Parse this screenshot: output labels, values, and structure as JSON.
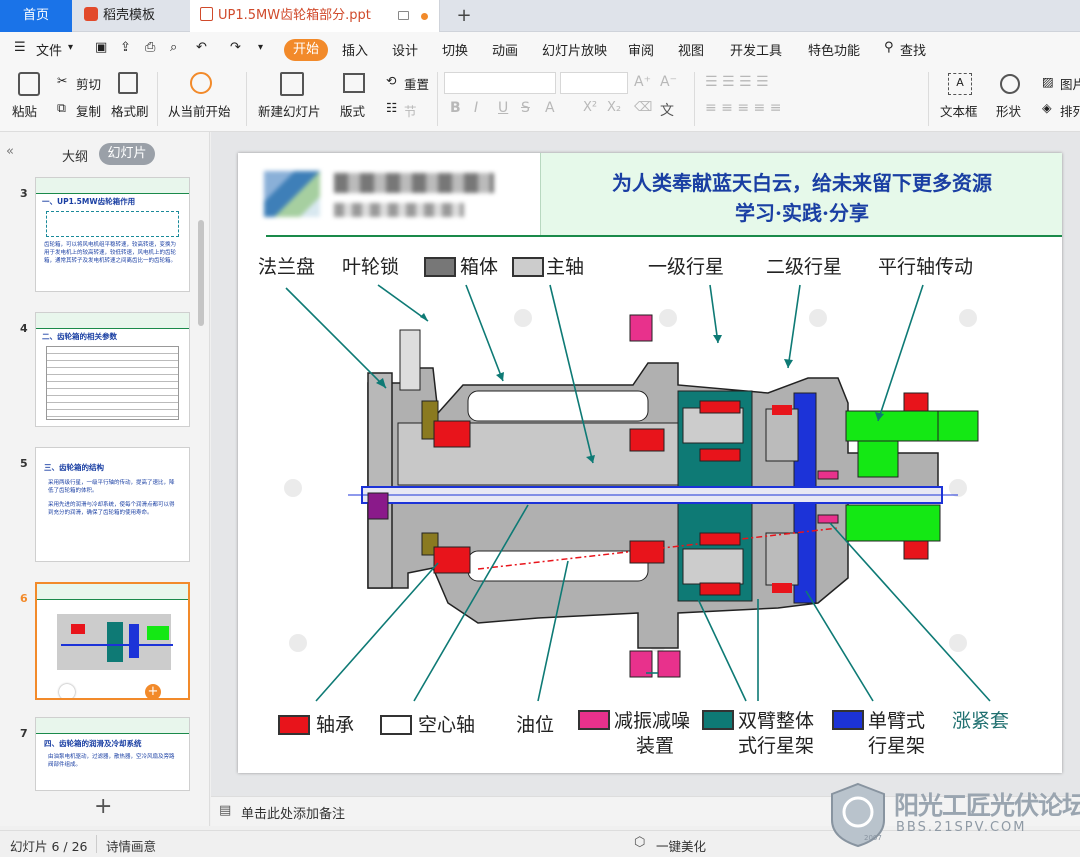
{
  "tabs": {
    "home": "首页",
    "template": "稻壳模板",
    "file": "UP1.5MW齿轮箱部分.ppt"
  },
  "menu": {
    "file": "文件",
    "items": [
      "开始",
      "插入",
      "设计",
      "切换",
      "动画",
      "幻灯片放映",
      "审阅",
      "视图",
      "开发工具",
      "特色功能"
    ],
    "search": "查找"
  },
  "ribbon": {
    "paste": "粘贴",
    "cut": "剪切",
    "copy": "复制",
    "format_painter": "格式刷",
    "from_current": "从当前开始",
    "new_slide": "新建幻灯片",
    "layout": "版式",
    "reset": "重置",
    "section": "节",
    "textbox": "文本框",
    "shape": "形状",
    "picture": "图片",
    "arrange": "排列"
  },
  "panel": {
    "outline": "大纲",
    "slides": "幻灯片",
    "thumbs": [
      {
        "num": "3",
        "title": "一、UP1.5MW齿轮箱作用",
        "body": "齿轮箱，可以将风电机组平稳转速，较高转速，变换为用于发电机上的较高转速，较低转速，风电机上的齿轮箱，通常其转子及发电机转速之间离齿比一的齿轮箱。"
      },
      {
        "num": "4",
        "title": "二、齿轮箱的相关参数"
      },
      {
        "num": "5",
        "title": "三、齿轮箱的结构",
        "body": "采用两级行星，一级平行轴的传动，提高了速比，降低了齿轮箱的体积。",
        "body2": "采用先进的润滑与冷却系统，使每个润滑点都可以得到充分的润滑，确保了齿轮箱的使用寿命。"
      },
      {
        "num": "6"
      },
      {
        "num": "7",
        "title": "四、齿轮箱的润滑及冷却系统",
        "body": "由油泵电机驱动，过滤器，散热器，空冷风扇及旁路阀部件组成。"
      }
    ]
  },
  "slide": {
    "header_line1": "为人类奉献蓝天白云，给未来留下更多资源",
    "header_line2": "学习·实践·分享",
    "top_labels": {
      "flange": "法兰盘",
      "rotor_lock": "叶轮锁",
      "housing": "箱体",
      "main_shaft": "主轴",
      "stage1": "一级行星",
      "stage2": "二级行星",
      "parallel": "平行轴传动"
    },
    "bottom_labels": {
      "bearing": "轴承",
      "hollow": "空心轴",
      "oil": "油位",
      "damper1": "减振减噪",
      "damper2": "装置",
      "double1": "双臂整体",
      "double2": "式行星架",
      "single1": "单臂式",
      "single2": "行星架",
      "shrink": "涨紧套"
    },
    "watermark": "阳光工匠论坛"
  },
  "notes": "单击此处添加备注",
  "status": {
    "slide": "幻灯片 6 / 26",
    "theme": "诗情画意",
    "beautify": "一键美化"
  },
  "brand": {
    "name": "阳光工匠光伏论坛",
    "url": "BBS.21SPV.COM",
    "year": "2007"
  },
  "colors": {
    "accent": "#1a73e8",
    "orange": "#f28a2a",
    "teal": "#0e7a75",
    "red": "#e8141b",
    "pink": "#e8318c",
    "blue": "#1c33d8",
    "green": "#14e814",
    "gray": "#b0b0b0"
  }
}
